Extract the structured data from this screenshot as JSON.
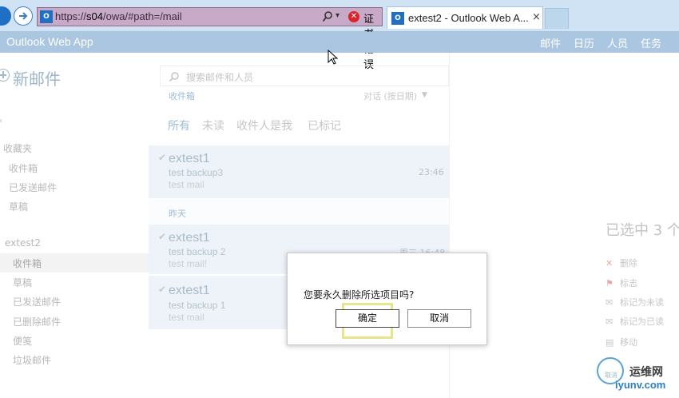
{
  "browser": {
    "url_prefix": "https://",
    "url_host": "s04",
    "url_path": "/owa/#path=/mail",
    "cert_error": "证书错误",
    "tab_title": "extest2 - Outlook Web A...",
    "tab_close": "×",
    "owa_icon_text": "O"
  },
  "header": {
    "app_name": "Outlook Web App",
    "nav": [
      "邮件",
      "日历",
      "人员",
      "任务"
    ]
  },
  "sidebar": {
    "new_mail": "新邮件",
    "collapse": "«",
    "favorites": {
      "title": "收藏夹",
      "items": [
        "收件箱",
        "已发送邮件",
        "草稿"
      ]
    },
    "account": {
      "name": "extest2",
      "items": [
        "收件箱",
        "草稿",
        "已发送邮件",
        "已删除邮件",
        "便笺",
        "垃圾邮件"
      ],
      "selected_index": 0
    }
  },
  "list": {
    "search_placeholder": "搜索邮件和人员",
    "folder": "收件箱",
    "sort": "对话 (按日期)",
    "filters": [
      "所有",
      "未读",
      "收件人是我",
      "已标记"
    ],
    "active_filter": 0,
    "day_separator": "昨天",
    "messages": [
      {
        "from": "extest1",
        "subject": "test backup3",
        "preview": "test mail",
        "time": "23:46"
      },
      {
        "from": "extest1",
        "subject": "test backup 2",
        "preview": "test mail!",
        "time": "周三 16:48"
      },
      {
        "from": "extest1",
        "subject": "test backup 1",
        "preview": "test mail",
        "time": ""
      }
    ]
  },
  "reading_pane": {
    "selected_count": "已选中 3 个",
    "actions": [
      {
        "icon": "delete-icon",
        "label": "删除"
      },
      {
        "icon": "flag-icon",
        "label": "标志"
      },
      {
        "icon": "mark-unread-icon",
        "label": "标记为未读"
      },
      {
        "icon": "mark-read-icon",
        "label": "标记为已读"
      },
      {
        "icon": "move-icon",
        "label": "移动"
      }
    ]
  },
  "dialog": {
    "message": "您要永久删除所选项目吗?",
    "ok": "确定",
    "cancel": "取消"
  },
  "watermark": {
    "cn": "运维网",
    "url": "iyunv.com",
    "sub": "取消"
  },
  "colors": {
    "header_bg": "#aac6e0",
    "accent": "#9dbcd6",
    "selected_row_bg": "#edf3f9",
    "address_bar_error": "#c9a9c8",
    "cert_error_red": "#d8262b",
    "highlight": "#e6e58c"
  }
}
